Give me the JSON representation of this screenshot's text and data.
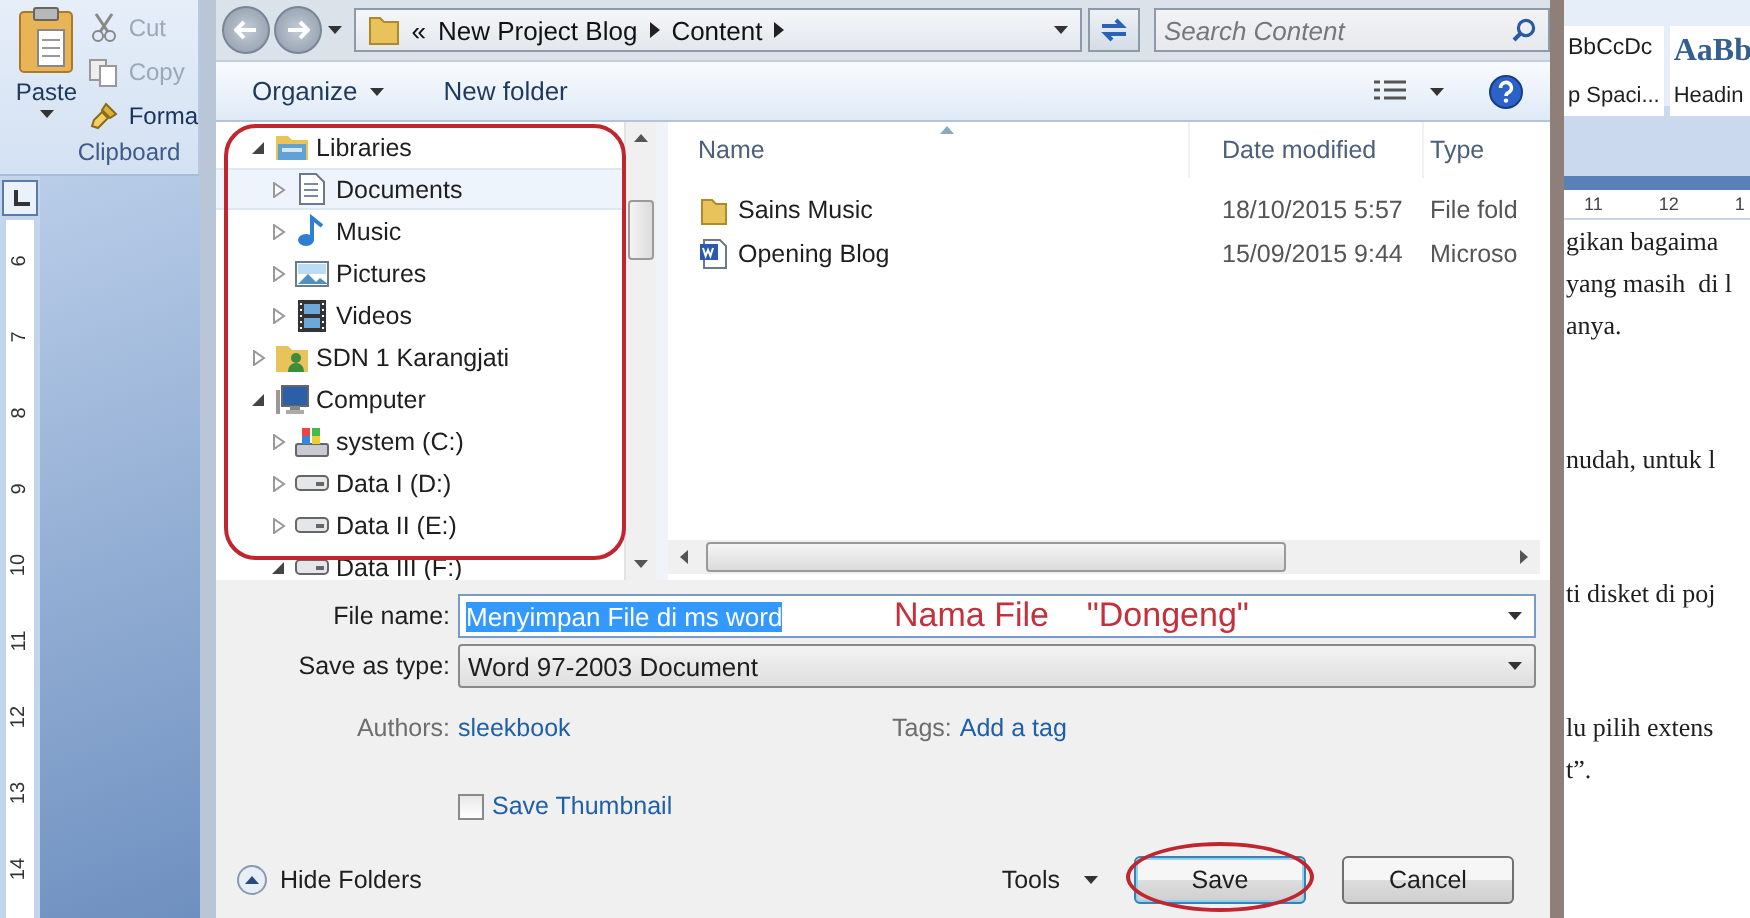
{
  "word": {
    "clipboard": {
      "paste": "Paste",
      "cut": {
        "label": "Cut",
        "disabled": true
      },
      "copy": {
        "label": "Copy",
        "disabled": true
      },
      "format": {
        "label": "Forma",
        "disabled": false
      },
      "group_label": "Clipboard"
    },
    "vertical_ruler": [
      "6",
      "7",
      "8",
      "9",
      "10",
      "11",
      "12",
      "13",
      "14"
    ],
    "styles": [
      {
        "kind": "normal",
        "preview": "BbCcDc",
        "name": "p Spaci..."
      },
      {
        "kind": "heading",
        "preview": "AaBb",
        "name": "Headin"
      }
    ],
    "horizontal_ruler": [
      "11",
      "12",
      "1"
    ],
    "document_paragraphs": [
      [
        "gikan bagaima",
        "yang masih  di l",
        "anya."
      ],
      [
        "nudah, untuk l"
      ],
      [
        "ti disket di poj"
      ],
      [
        "lu pilih extens",
        "t”."
      ]
    ]
  },
  "dialog": {
    "address": {
      "overflow": "«",
      "path": [
        "New Project Blog",
        "Content"
      ]
    },
    "search": {
      "placeholder": "Search Content"
    },
    "toolbar": {
      "organize": "Organize",
      "new_folder": "New folder"
    },
    "tree": [
      {
        "label": "Libraries",
        "kind": "library",
        "expanded": true,
        "selected": false,
        "children": [
          {
            "label": "Documents",
            "kind": "documents",
            "expanded": false,
            "selected": true
          },
          {
            "label": "Music",
            "kind": "music",
            "expanded": false,
            "selected": false
          },
          {
            "label": "Pictures",
            "kind": "pictures",
            "expanded": false,
            "selected": false
          },
          {
            "label": "Videos",
            "kind": "videos",
            "expanded": false,
            "selected": false
          }
        ]
      },
      {
        "label": "SDN 1 Karangjati",
        "kind": "user-folder",
        "expanded": false,
        "selected": false
      },
      {
        "label": "Computer",
        "kind": "computer",
        "expanded": true,
        "selected": false,
        "children": [
          {
            "label": "system (C:)",
            "kind": "system-drive",
            "expanded": false,
            "selected": false
          },
          {
            "label": "Data I (D:)",
            "kind": "drive",
            "expanded": false,
            "selected": false
          },
          {
            "label": "Data II (E:)",
            "kind": "drive",
            "expanded": false,
            "selected": false
          },
          {
            "label": "Data III (F:)",
            "kind": "drive",
            "expanded": true,
            "selected": false
          }
        ]
      }
    ],
    "columns": [
      "Name",
      "Date modified",
      "Type"
    ],
    "files": [
      {
        "kind": "folder",
        "name": "Sains Music",
        "date": "18/10/2015 5:57",
        "type": "File fold"
      },
      {
        "kind": "word",
        "name": "Opening Blog",
        "date": "15/09/2015 9:44",
        "type": "Microso"
      }
    ],
    "file_name": {
      "label": "File name:",
      "value": "Menyimpan File di ms word",
      "selected": true
    },
    "save_as_type": {
      "label": "Save as type:",
      "value": "Word 97-2003 Document"
    },
    "authors": {
      "label": "Authors:",
      "value": "sleekbook"
    },
    "tags": {
      "label": "Tags:",
      "value": "Add a tag"
    },
    "save_thumbnail": {
      "label": "Save Thumbnail",
      "checked": false
    },
    "hide_folders": "Hide Folders",
    "tools": "Tools",
    "buttons": [
      "Save",
      "Cancel"
    ]
  },
  "annotation": {
    "label": "Nama File    \"Dongeng\""
  }
}
